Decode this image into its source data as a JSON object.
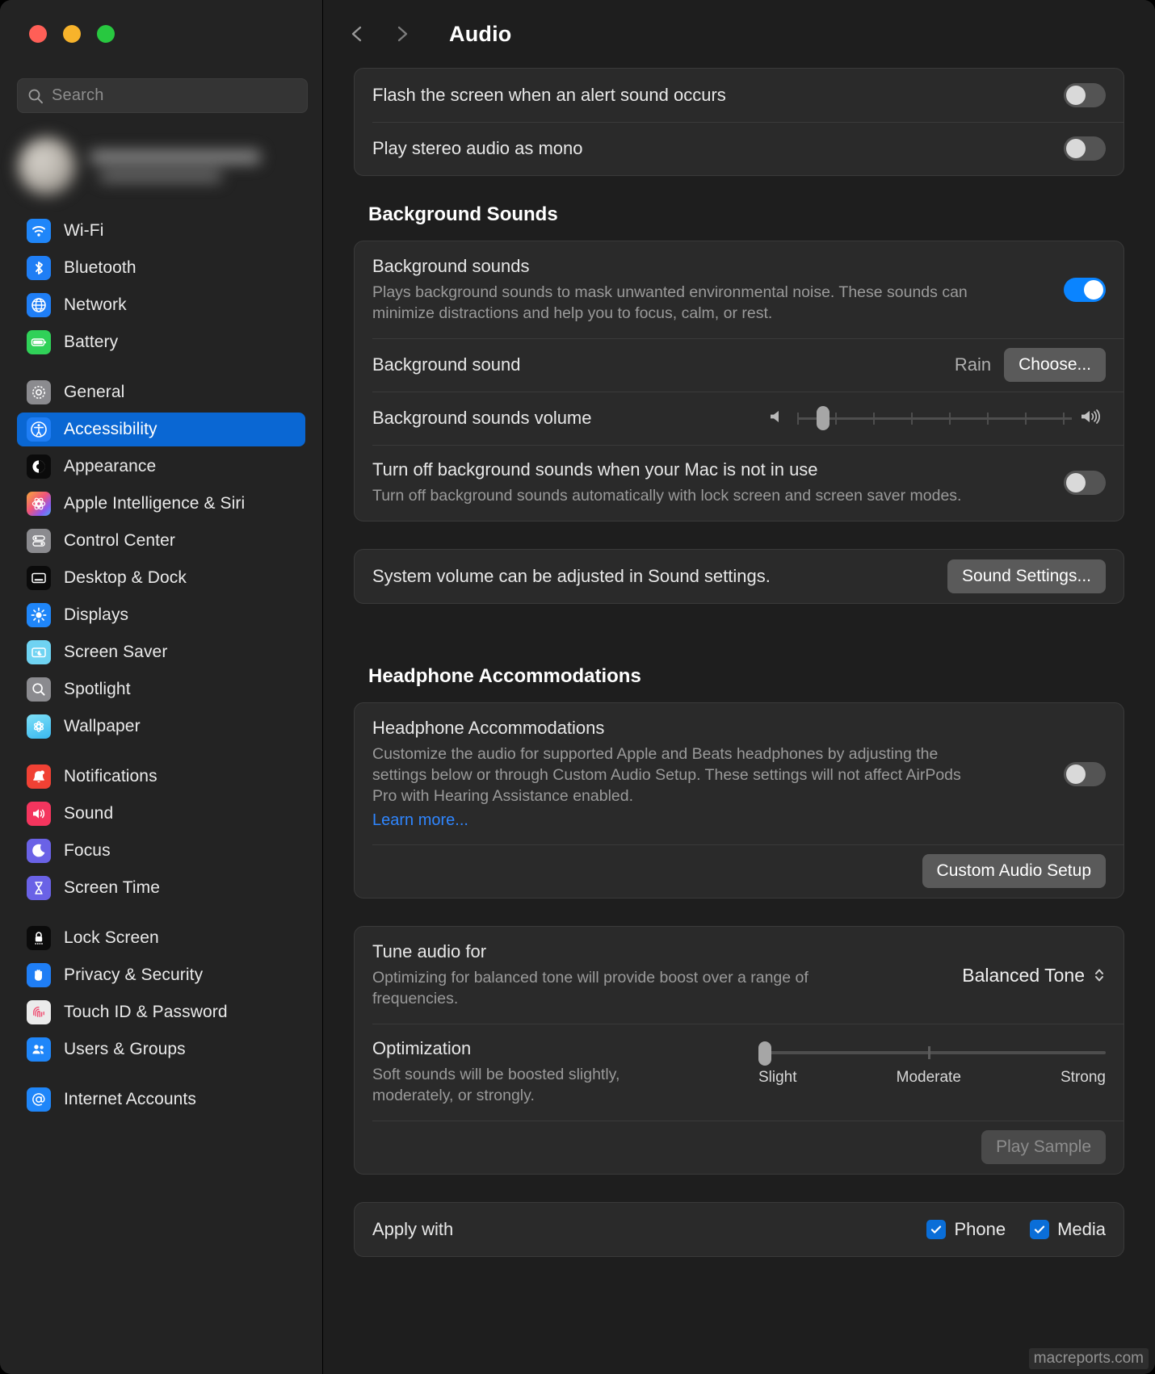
{
  "window": {
    "traffic_lights": [
      "close",
      "minimize",
      "zoom"
    ],
    "colors": {
      "close": "#ff5f57",
      "minimize": "#f7b32b",
      "zoom": "#28c840",
      "accent": "#0a84ff",
      "selection": "#0a67d3",
      "link": "#2f86ff",
      "annotation_arrow": "#e23b36"
    }
  },
  "sidebar": {
    "search": {
      "placeholder": "Search",
      "value": "",
      "icon": "search-icon"
    },
    "profile": {
      "blurred": true
    },
    "groups": [
      {
        "items": [
          {
            "label": "Wi-Fi",
            "icon": "wifi-icon"
          },
          {
            "label": "Bluetooth",
            "icon": "bluetooth-icon"
          },
          {
            "label": "Network",
            "icon": "globe-icon"
          },
          {
            "label": "Battery",
            "icon": "battery-icon"
          }
        ]
      },
      {
        "items": [
          {
            "label": "General",
            "icon": "gear-icon"
          },
          {
            "label": "Accessibility",
            "icon": "accessibility-icon",
            "selected": true
          },
          {
            "label": "Appearance",
            "icon": "appearance-icon"
          },
          {
            "label": "Apple Intelligence & Siri",
            "icon": "apple-intelligence-icon"
          },
          {
            "label": "Control Center",
            "icon": "control-center-icon"
          },
          {
            "label": "Desktop & Dock",
            "icon": "desktop-dock-icon"
          },
          {
            "label": "Displays",
            "icon": "brightness-icon"
          },
          {
            "label": "Screen Saver",
            "icon": "screen-saver-icon"
          },
          {
            "label": "Spotlight",
            "icon": "spotlight-icon"
          },
          {
            "label": "Wallpaper",
            "icon": "wallpaper-icon"
          }
        ]
      },
      {
        "items": [
          {
            "label": "Notifications",
            "icon": "bell-icon"
          },
          {
            "label": "Sound",
            "icon": "speaker-icon"
          },
          {
            "label": "Focus",
            "icon": "moon-icon"
          },
          {
            "label": "Screen Time",
            "icon": "hourglass-icon"
          }
        ]
      },
      {
        "items": [
          {
            "label": "Lock Screen",
            "icon": "lock-icon"
          },
          {
            "label": "Privacy & Security",
            "icon": "hand-icon"
          },
          {
            "label": "Touch ID & Password",
            "icon": "fingerprint-icon"
          },
          {
            "label": "Users & Groups",
            "icon": "users-icon"
          }
        ]
      },
      {
        "items": [
          {
            "label": "Internet Accounts",
            "icon": "at-icon"
          }
        ]
      }
    ]
  },
  "toolbar": {
    "back_icon": "chevron-left-icon",
    "forward_icon": "chevron-right-icon",
    "title": "Audio"
  },
  "main": {
    "alert_card": {
      "flash_screen_label": "Flash the screen when an alert sound occurs",
      "flash_screen_state": "off",
      "mono_label": "Play stereo audio as mono",
      "mono_state": "off"
    },
    "background_sounds": {
      "section_title": "Background Sounds",
      "toggle_title": "Background sounds",
      "toggle_desc": "Plays background sounds to mask unwanted environmental noise. These sounds can minimize distractions and help you to focus, calm, or rest.",
      "toggle_state": "on",
      "sound_label": "Background sound",
      "sound_value": "Rain",
      "choose_button": "Choose...",
      "volume_label": "Background sounds volume",
      "volume_percent": 7,
      "volume_low_icon": "speaker-low-icon",
      "volume_high_icon": "speaker-high-icon",
      "turn_off_title": "Turn off background sounds when your Mac is not in use",
      "turn_off_desc": "Turn off background sounds automatically with lock screen and screen saver modes.",
      "turn_off_state": "off"
    },
    "system_volume_note": {
      "text": "System volume can be adjusted in Sound settings.",
      "button": "Sound Settings..."
    },
    "headphone": {
      "section_title": "Headphone Accommodations",
      "toggle_title": "Headphone Accommodations",
      "toggle_desc": "Customize the audio for supported Apple and Beats headphones by adjusting the settings below or through Custom Audio Setup. These settings will not affect AirPods Pro with Hearing Assistance enabled.",
      "learn_more": "Learn more...",
      "toggle_state": "off",
      "custom_audio_setup_button": "Custom Audio Setup"
    },
    "tune_audio": {
      "title": "Tune audio for",
      "desc": "Optimizing for balanced tone will provide boost over a range of frequencies.",
      "value": "Balanced Tone",
      "popup_icon": "chevron-updown-icon",
      "optimization_title": "Optimization",
      "optimization_desc": "Soft sounds will be boosted slightly, moderately, or strongly.",
      "optimization_value": 0,
      "optimization_ticks": [
        "Slight",
        "Moderate",
        "Strong"
      ],
      "play_sample_button": "Play Sample",
      "play_sample_disabled": true
    },
    "apply_with": {
      "label": "Apply with",
      "options": [
        {
          "label": "Phone",
          "checked": true
        },
        {
          "label": "Media",
          "checked": true
        }
      ]
    }
  },
  "watermark": "macreports.com"
}
